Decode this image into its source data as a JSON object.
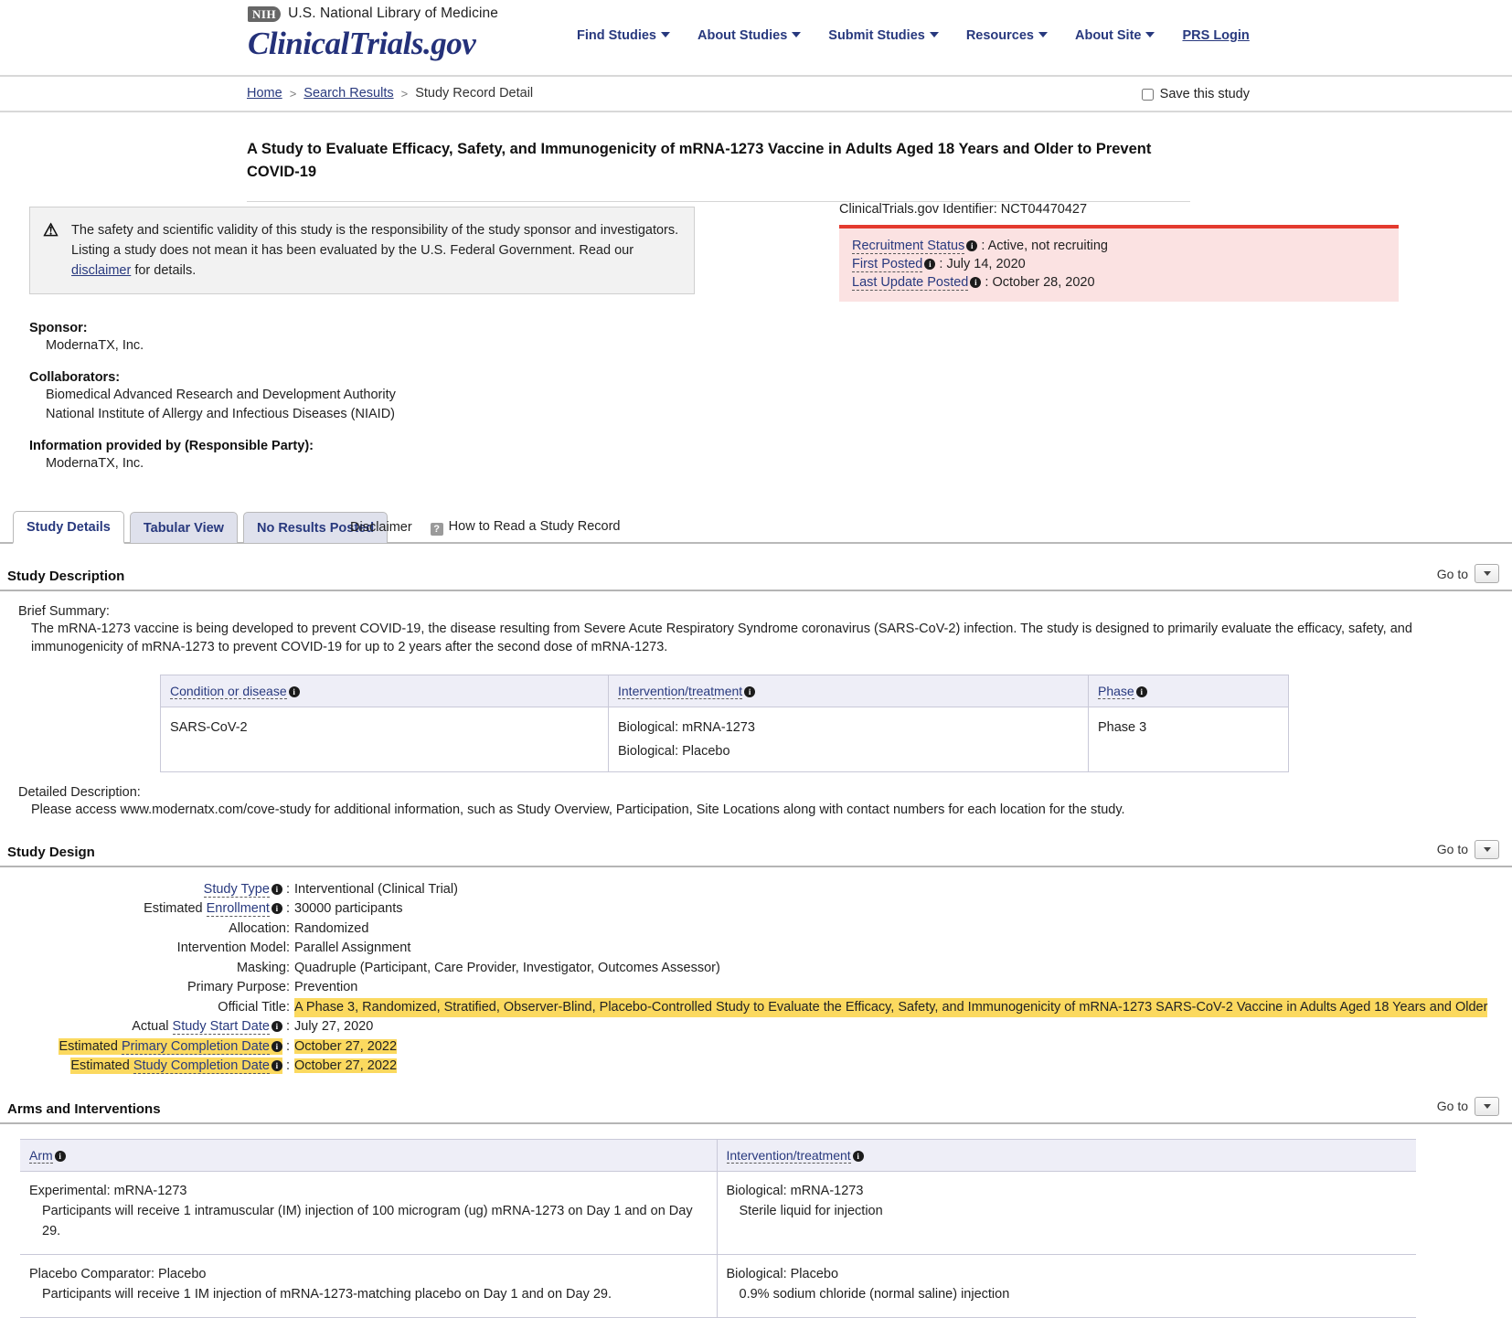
{
  "masthead": {
    "nih_logo_text": "NIH",
    "nlm_text": "U.S. National Library of Medicine",
    "site_logo": "ClinicalTrials.gov",
    "nav": [
      {
        "label": "Find Studies",
        "has_caret": true
      },
      {
        "label": "About Studies",
        "has_caret": true
      },
      {
        "label": "Submit Studies",
        "has_caret": true
      },
      {
        "label": "Resources",
        "has_caret": true
      },
      {
        "label": "About Site",
        "has_caret": true
      },
      {
        "label": "PRS Login",
        "has_caret": false
      }
    ]
  },
  "breadcrumb": {
    "home": "Home",
    "sep1": ">",
    "search_results": "Search Results",
    "sep2": ">",
    "current": "Study Record Detail",
    "save_label": "Save this study"
  },
  "study": {
    "title": "A Study to Evaluate Efficacy, Safety, and Immunogenicity of mRNA-1273 Vaccine in Adults Aged 18 Years and Older to Prevent COVID-19"
  },
  "disclaimer": {
    "icon": "warning-icon",
    "text_part1": "The safety and scientific validity of this study is the responsibility of the study sponsor and investigators. Listing a study does not mean it has been evaluated by the U.S. Federal Government. Read our ",
    "link": "disclaimer",
    "text_part2": " for details."
  },
  "status": {
    "identifier_label": "ClinicalTrials.gov Identifier: NCT04470427",
    "rows": [
      {
        "label": "Recruitment Status",
        "value": ": Active, not recruiting"
      },
      {
        "label": "First Posted",
        "value": ": July 14, 2020"
      },
      {
        "label": "Last Update Posted",
        "value": ": October 28, 2020"
      }
    ]
  },
  "parties": [
    {
      "heading": "Sponsor:",
      "values": [
        "ModernaTX, Inc."
      ]
    },
    {
      "heading": "Collaborators:",
      "values": [
        "Biomedical Advanced Research and Development Authority",
        "National Institute of Allergy and Infectious Diseases (NIAID)"
      ]
    },
    {
      "heading": "Information provided by (Responsible Party):",
      "values": [
        "ModernaTX, Inc."
      ]
    }
  ],
  "tabs": [
    {
      "label": "Study Details",
      "active": true
    },
    {
      "label": "Tabular View",
      "active": false
    },
    {
      "label": "No Results Posted",
      "active": false
    }
  ],
  "tab_extras": {
    "disclaimer": "Disclaimer",
    "how_to_read": "How to Read a Study Record"
  },
  "goto_label": "Go to",
  "study_description": {
    "heading": "Study Description",
    "brief_summary_label": "Brief Summary:",
    "brief_summary": "The mRNA-1273 vaccine is being developed to prevent COVID-19, the disease resulting from Severe Acute Respiratory Syndrome coronavirus (SARS-CoV-2) infection. The study is designed to primarily evaluate the efficacy, safety, and immunogenicity of mRNA-1273 to prevent COVID-19 for up to 2 years after the second dose of mRNA-1273.",
    "detailed_description_label": "Detailed Description:",
    "detailed_description": "Please access www.modernatx.com/cove-study for additional information, such as Study Overview, Participation, Site Locations along with contact numbers for each location for the study.",
    "table": {
      "headers": [
        "Condition or disease",
        "Intervention/treatment",
        "Phase"
      ],
      "rows": [
        {
          "condition": "SARS-CoV-2",
          "interventions": [
            "Biological: mRNA-1273",
            "Biological: Placebo"
          ],
          "phase": "Phase 3"
        }
      ]
    }
  },
  "study_design": {
    "heading": "Study Design",
    "rows": [
      {
        "label_prefix": "",
        "label_link": "Study Type",
        "label_suffix": "",
        "colon": ":",
        "value": "Interventional  (Clinical Trial)",
        "label_highlight": false,
        "value_highlight": false,
        "has_info": true
      },
      {
        "label_prefix": "Estimated ",
        "label_link": "Enrollment",
        "label_suffix": "",
        "colon": ":",
        "value": "30000 participants",
        "label_highlight": false,
        "value_highlight": false,
        "has_info": true
      },
      {
        "label_prefix": "Allocation:",
        "label_link": "",
        "label_suffix": "",
        "colon": "",
        "value": "Randomized",
        "label_highlight": false,
        "value_highlight": false,
        "has_info": false
      },
      {
        "label_prefix": "Intervention Model:",
        "label_link": "",
        "label_suffix": "",
        "colon": "",
        "value": "Parallel Assignment",
        "label_highlight": false,
        "value_highlight": false,
        "has_info": false
      },
      {
        "label_prefix": "Masking:",
        "label_link": "",
        "label_suffix": "",
        "colon": "",
        "value": "Quadruple (Participant, Care Provider, Investigator, Outcomes Assessor)",
        "label_highlight": false,
        "value_highlight": false,
        "has_info": false
      },
      {
        "label_prefix": "Primary Purpose:",
        "label_link": "",
        "label_suffix": "",
        "colon": "",
        "value": "Prevention",
        "label_highlight": false,
        "value_highlight": false,
        "has_info": false
      },
      {
        "label_prefix": "Official Title:",
        "label_link": "",
        "label_suffix": "",
        "colon": "",
        "value": "A Phase 3, Randomized, Stratified, Observer-Blind, Placebo-Controlled Study to Evaluate the Efficacy, Safety, and Immunogenicity of mRNA-1273 SARS-CoV-2 Vaccine in Adults Aged 18 Years and Older",
        "label_highlight": false,
        "value_highlight": true,
        "has_info": false
      },
      {
        "label_prefix": "Actual ",
        "label_link": "Study Start Date",
        "label_suffix": "",
        "colon": ":",
        "value": "July 27, 2020",
        "label_highlight": false,
        "value_highlight": false,
        "has_info": true
      },
      {
        "label_prefix": "Estimated ",
        "label_link": "Primary Completion Date",
        "label_suffix": "",
        "colon": ":",
        "value": "October 27, 2022",
        "label_highlight": true,
        "value_highlight": true,
        "has_info": true
      },
      {
        "label_prefix": "Estimated ",
        "label_link": "Study Completion Date",
        "label_suffix": "",
        "colon": ":",
        "value": "October 27, 2022",
        "label_highlight": true,
        "value_highlight": true,
        "has_info": true
      }
    ]
  },
  "arms": {
    "heading": "Arms and Interventions",
    "headers": [
      "Arm",
      "Intervention/treatment"
    ],
    "rows": [
      {
        "arm_name": "Experimental: mRNA-1273",
        "arm_desc": "Participants will receive 1 intramuscular (IM) injection of 100 microgram (ug) mRNA-1273 on Day 1 and on Day 29.",
        "int_name": "Biological: mRNA-1273",
        "int_desc": "Sterile liquid for injection"
      },
      {
        "arm_name": "Placebo Comparator: Placebo",
        "arm_desc": "Participants will receive 1 IM injection of mRNA-1273-matching placebo on Day 1 and on Day 29.",
        "int_name": "Biological: Placebo",
        "int_desc": "0.9% sodium chloride (normal saline) injection"
      }
    ]
  }
}
